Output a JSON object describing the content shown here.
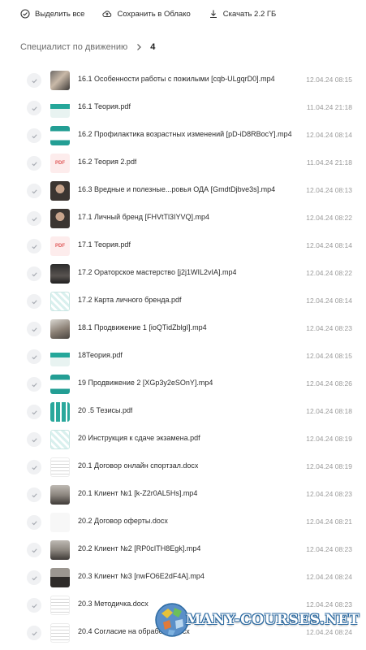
{
  "toolbar": {
    "select_all_label": "Выделить все",
    "save_cloud_label": "Сохранить в Облако",
    "download_label": "Скачать 2.2 ГБ"
  },
  "breadcrumb": {
    "parent": "Специалист по движению",
    "current": "4"
  },
  "files": [
    {
      "name": "16.1 Особенности работы с пожилыми [cqb-ULgqrD0].mp4",
      "date": "12.04.24 08:15",
      "thumb": "video"
    },
    {
      "name": "16.1 Теория.pdf",
      "date": "11.04.24 21:18",
      "thumb": "green"
    },
    {
      "name": "16.2 Профилактика возрастных изменений [pD-iD8RBocY].mp4",
      "date": "12.04.24 08:14",
      "thumb": "greenframe"
    },
    {
      "name": "16.2 Теория 2.pdf",
      "date": "11.04.24 21:18",
      "thumb": "pdf"
    },
    {
      "name": "16.3 Вредные и полезные...ровья ОДА [GmdtDjbve3s].mp4",
      "date": "12.04.24 08:13",
      "thumb": "person"
    },
    {
      "name": "17.1 Личный бренд [FHVtTl3IYVQ].mp4",
      "date": "12.04.24 08:22",
      "thumb": "person"
    },
    {
      "name": "17.1 Теория.pdf",
      "date": "12.04.24 08:14",
      "thumb": "pdf"
    },
    {
      "name": "17.2 Ораторское мастерство [j2j1WIL2vIA].mp4",
      "date": "12.04.24 08:22",
      "thumb": "dark"
    },
    {
      "name": "17.2 Карта личного бренда.pdf",
      "date": "12.04.24 08:14",
      "thumb": "map"
    },
    {
      "name": "18.1 Продвижение 1 [ioQTidZblgI].mp4",
      "date": "12.04.24 08:23",
      "thumb": "video2"
    },
    {
      "name": "18Теория.pdf",
      "date": "12.04.24 08:15",
      "thumb": "green"
    },
    {
      "name": "19 Продвижение 2 [XGp3y2eSOnY].mp4",
      "date": "12.04.24 08:26",
      "thumb": "greenframe"
    },
    {
      "name": "20 .5 Тезисы.pdf",
      "date": "12.04.24 08:18",
      "thumb": "grid"
    },
    {
      "name": "20 Инструкция к сдаче экзамена.pdf",
      "date": "12.04.24 08:19",
      "thumb": "map"
    },
    {
      "name": "20.1 Договор онлайн спортзал.docx",
      "date": "12.04.24 08:19",
      "thumb": "doc"
    },
    {
      "name": "20.1 Клиент №1 [k-Z2r0AL5Hs].mp4",
      "date": "12.04.24 08:23",
      "thumb": "room"
    },
    {
      "name": "20.2 Договор оферты.docx",
      "date": "12.04.24 08:21",
      "thumb": "blank"
    },
    {
      "name": "20.2 Клиент №2 [RP0cITH8Egk].mp4",
      "date": "12.04.24 08:23",
      "thumb": "room"
    },
    {
      "name": "20.3 Клиент №3 [nwFO6E2dF4A].mp4",
      "date": "12.04.24 08:24",
      "thumb": "floor"
    },
    {
      "name": "20.3 Методичка.docx",
      "date": "12.04.24 08:23",
      "thumb": "doc"
    },
    {
      "name": "20.4 Согласие на обработку.docx",
      "date": "12.04.24 08:24",
      "thumb": "doc"
    }
  ],
  "pdf_badge": "PDF",
  "watermark": "MANY-COURSES.NET",
  "colors": {
    "accent_green": "#25a79a",
    "pdf_red": "#e15b5b",
    "date_gray": "#9a9a9a",
    "check_bg": "#f0f1f3"
  }
}
